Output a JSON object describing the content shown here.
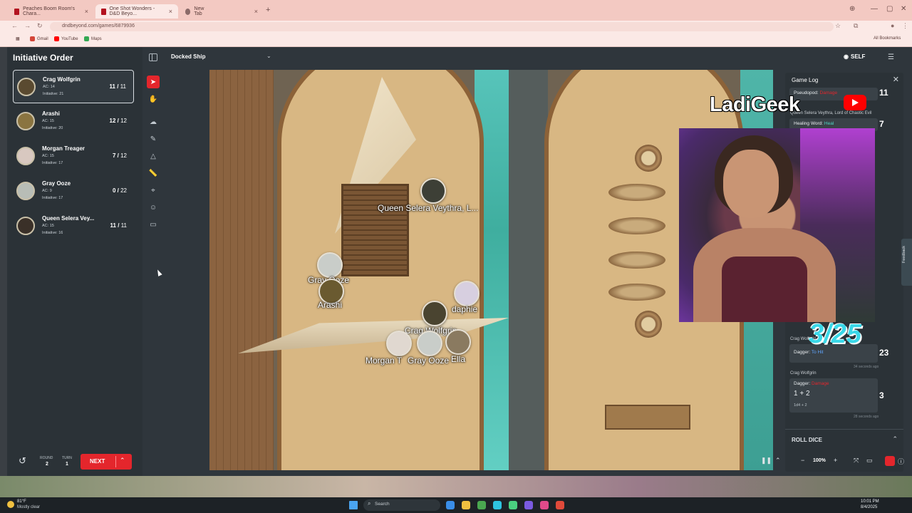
{
  "browser": {
    "tabs": [
      {
        "label": "Peaches Boom Room's Chara...",
        "active": false
      },
      {
        "label": "One Shot Wonders - D&D Beyo...",
        "active": true
      },
      {
        "label": "New Tab",
        "active": false
      }
    ],
    "url": "dndbeyond.com/games/6879936",
    "bookmarks": [
      "Gmail",
      "YouTube",
      "Maps"
    ],
    "all_bookmarks": "All Bookmarks"
  },
  "sidebar": {
    "title": "Initiative Order",
    "combatants": [
      {
        "name": "Crag Wolfgrin",
        "ac": "AC: 14",
        "initiative": "Initiative: 21",
        "hp": "11",
        "max": "11",
        "active": true
      },
      {
        "name": "Arashi",
        "ac": "AC: 15",
        "initiative": "Initiative: 20",
        "hp": "12",
        "max": "12",
        "active": false
      },
      {
        "name": "Morgan Treager",
        "ac": "AC: 15",
        "initiative": "Initiative: 17",
        "hp": "7",
        "max": "12",
        "active": false
      },
      {
        "name": "Gray Ooze",
        "ac": "AC: 9",
        "initiative": "Initiative: 17",
        "hp": "0",
        "max": "22",
        "active": false
      },
      {
        "name": "Queen Selera Vey...",
        "ac": "AC: 15",
        "initiative": "Initiative: 16",
        "hp": "11",
        "max": "11",
        "active": false
      }
    ],
    "round_label": "ROUND",
    "round_value": "2",
    "turn_label": "TURN",
    "turn_value": "1",
    "next_label": "NEXT"
  },
  "header": {
    "map_name": "Docked Ship",
    "view_mode": "SELF"
  },
  "map": {
    "tokens": [
      {
        "label": "Queen Selera Veythra, L..."
      },
      {
        "label": "Gray Ooze"
      },
      {
        "label": "Arashi"
      },
      {
        "label": "daphie"
      },
      {
        "label": "Crag Wolfgrin"
      },
      {
        "label": "Morgan T"
      },
      {
        "label": "Gray Ooze"
      },
      {
        "label": "Ella"
      }
    ]
  },
  "gamelog": {
    "title": "Game Log",
    "entries": [
      {
        "action": "Pseudopod:",
        "type": "Damage",
        "total": "11"
      },
      {
        "who": "Queen Selera Veythra, Lord of Chaotic Evil"
      },
      {
        "action": "Healing Word:",
        "type": "Heal",
        "total": "7"
      },
      {
        "who": "Crag Wolfgrin"
      },
      {
        "action": "Dagger:",
        "type": "To Hit",
        "total": "23",
        "time": "34 seconds ago"
      },
      {
        "who": "Crag Wolfgrin"
      },
      {
        "action": "Dagger:",
        "type": "Damage",
        "expr": "1 + 2",
        "dice": "1d4 + 2",
        "total": "3",
        "time": "28 seconds ago"
      }
    ],
    "roll_dice": "ROLL DICE",
    "zoom": "100%"
  },
  "overlay": {
    "channel_name": "LadiGeek",
    "countdown": "3/25"
  },
  "feedback_label": "Feedback",
  "taskbar": {
    "temp": "81°F",
    "weather": "Mostly clear",
    "search_placeholder": "Search",
    "time": "10:01 PM",
    "date": "8/4/2025"
  },
  "colors": {
    "accent_red": "#e4262c",
    "heal_teal": "#4ed6c6",
    "tohit_blue": "#60a6ff",
    "countdown_cyan": "#3ad8e8"
  }
}
